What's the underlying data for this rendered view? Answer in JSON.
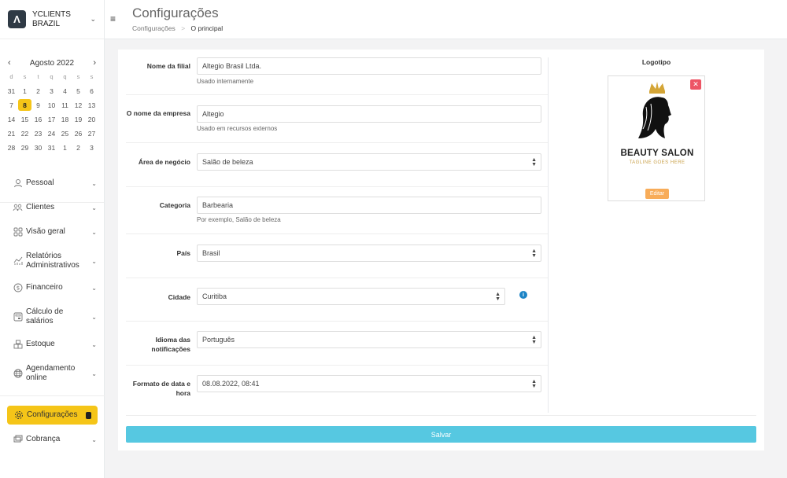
{
  "brand": {
    "name": "YCLIENTS BRAZIL",
    "logo_letter": "Λ"
  },
  "calendar": {
    "month_label": "Agosto 2022",
    "weekdays": [
      "d",
      "s",
      "t",
      "q",
      "q",
      "s",
      "s"
    ],
    "weeks": [
      [
        "31",
        "1",
        "2",
        "3",
        "4",
        "5",
        "6"
      ],
      [
        "7",
        "8",
        "9",
        "10",
        "11",
        "12",
        "13"
      ],
      [
        "14",
        "15",
        "16",
        "17",
        "18",
        "19",
        "20"
      ],
      [
        "21",
        "22",
        "23",
        "24",
        "25",
        "26",
        "27"
      ],
      [
        "28",
        "29",
        "30",
        "31",
        "1",
        "2",
        "3"
      ]
    ],
    "today": "8"
  },
  "menu": {
    "items": [
      {
        "label": "Pessoal",
        "icon": "user-icon"
      },
      {
        "label": "Clientes",
        "icon": "clients-icon"
      },
      {
        "label": "Visão geral",
        "icon": "grid-icon"
      },
      {
        "label": "Relatórios Administrativos",
        "icon": "reports-icon"
      },
      {
        "label": "Financeiro",
        "icon": "dollar-icon"
      },
      {
        "label": "Cálculo de salários",
        "icon": "calculator-icon"
      },
      {
        "label": "Estoque",
        "icon": "boxes-icon"
      },
      {
        "label": "Agendamento online",
        "icon": "globe-icon"
      }
    ],
    "active": {
      "label": "Configurações",
      "icon": "settings-icon"
    },
    "bottom": {
      "label": "Cobrança",
      "icon": "billing-icon"
    }
  },
  "header": {
    "title": "Configurações",
    "breadcrumb_root": "Configurações",
    "breadcrumb_sep": ">",
    "breadcrumb_current": "O principal"
  },
  "form": {
    "branch_name": {
      "label": "Nome da filial",
      "value": "Altegio Brasil Ltda.",
      "help": "Usado internamente"
    },
    "company_name": {
      "label": "O nome da empresa",
      "value": "Altegio",
      "help": "Usado em recursos externos"
    },
    "business_area": {
      "label": "Área de negócio",
      "value": "Salão de beleza"
    },
    "category": {
      "label": "Categoria",
      "value": "Barbearia",
      "help": "Por exemplo, Salão de beleza"
    },
    "country": {
      "label": "País",
      "value": "Brasil"
    },
    "city": {
      "label": "Cidade",
      "value": "Curitiba"
    },
    "notification_language": {
      "label": "Idioma das notificações",
      "value": "Português"
    },
    "datetime_format": {
      "label": "Formato de data e hora",
      "value": "08.08.2022, 08:41"
    }
  },
  "logo": {
    "title": "Logotipo",
    "brand_text": "BEAUTY SALON",
    "tagline": "TAGLINE GOES HERE",
    "edit_label": "Editar"
  },
  "save_label": "Salvar",
  "colors": {
    "accent": "#f5c518",
    "save": "#56c8e1",
    "edit": "#f8ac59",
    "remove": "#ed5565",
    "info": "#1c84c6"
  }
}
